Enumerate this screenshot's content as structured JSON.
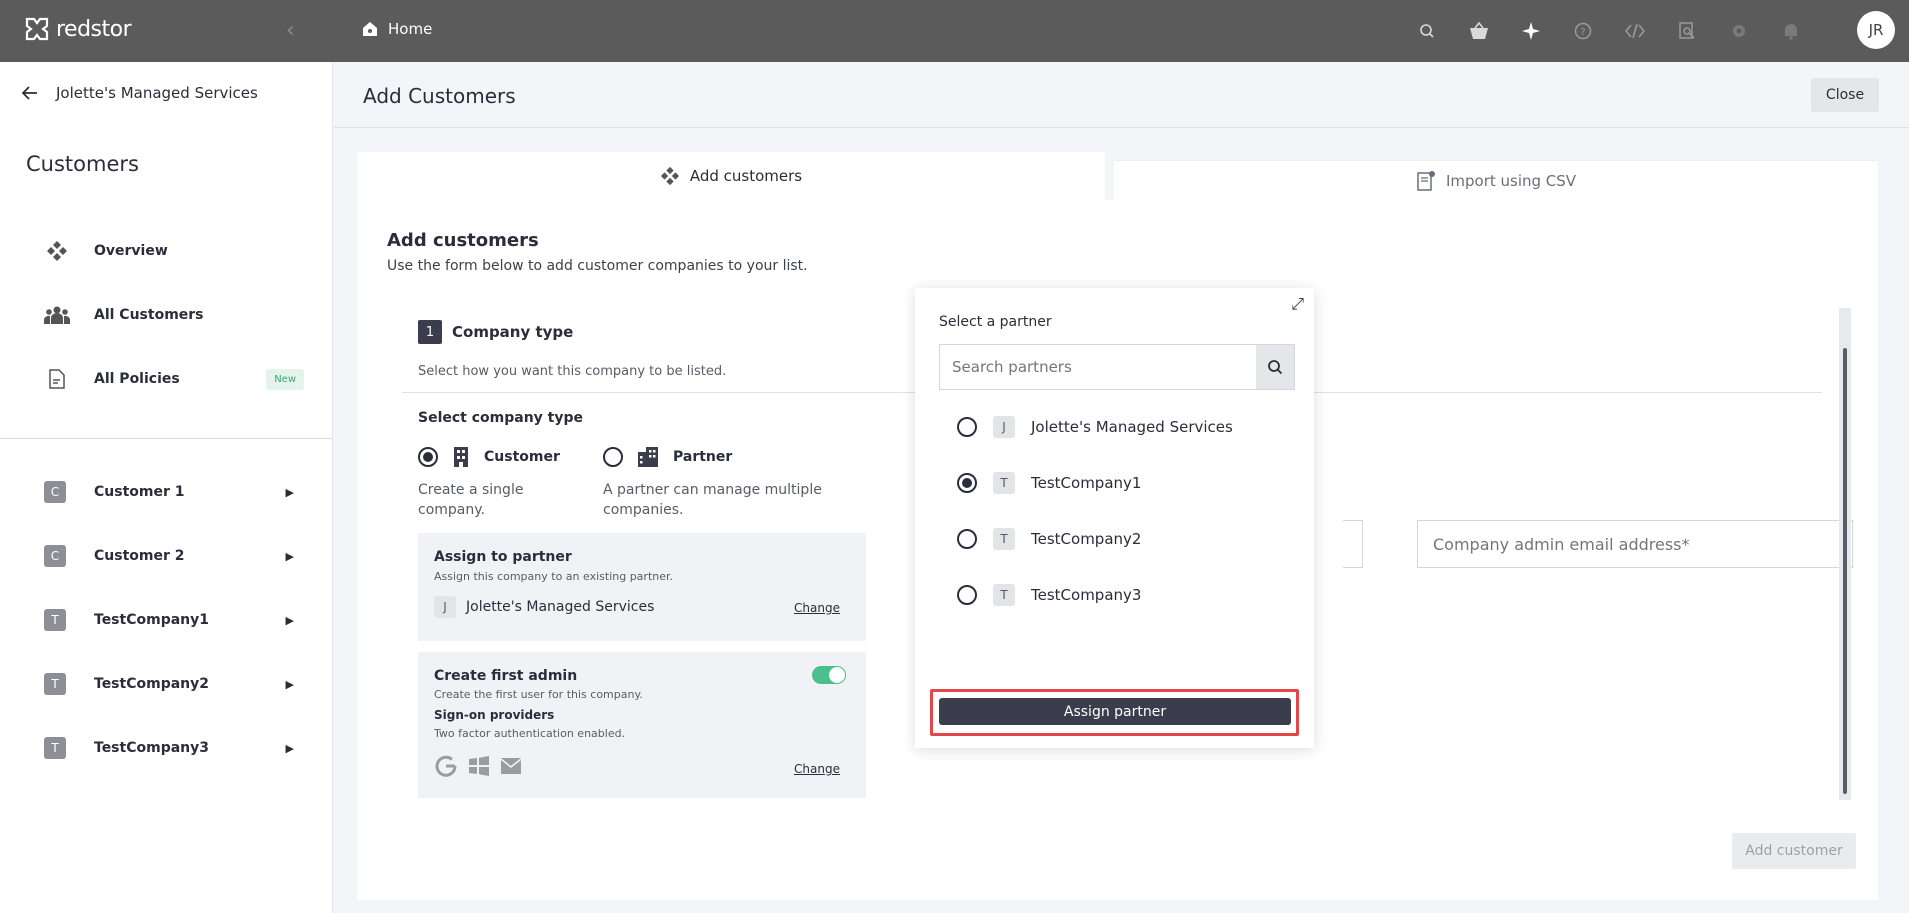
{
  "app": {
    "brand": "redstor",
    "breadcrumb": "Home",
    "user_initials": "JR"
  },
  "topbar": {
    "icons": [
      "search-icon",
      "basket-icon",
      "sparkle-icon",
      "help-icon",
      "code-icon",
      "inspect-icon",
      "gear-icon",
      "bell-icon"
    ]
  },
  "sidebar": {
    "back_label": "Jolette's Managed Services",
    "title": "Customers",
    "nav": [
      {
        "label": "Overview",
        "icon": "overview-icon"
      },
      {
        "label": "All Customers",
        "icon": "users-icon"
      },
      {
        "label": "All Policies",
        "icon": "document-icon",
        "badge": "New"
      }
    ],
    "customers": [
      {
        "letter": "C",
        "label": "Customer 1"
      },
      {
        "letter": "C",
        "label": "Customer 2"
      },
      {
        "letter": "T",
        "label": "TestCompany1"
      },
      {
        "letter": "T",
        "label": "TestCompany2"
      },
      {
        "letter": "T",
        "label": "TestCompany3"
      }
    ]
  },
  "main": {
    "title": "Add Customers",
    "close_label": "Close",
    "tabs": [
      {
        "label": "Add customers",
        "active": true
      },
      {
        "label": "Import using CSV",
        "active": false
      }
    ],
    "card": {
      "title": "Add customers",
      "subtitle": "Use the form below to add customer companies to your list.",
      "step_number": "1",
      "step_title": "Company type",
      "step_subtitle": "Select how you want this company to be listed.",
      "select_title": "Select company type",
      "types": [
        {
          "label": "Customer",
          "description": "Create a single company.",
          "checked": true
        },
        {
          "label": "Partner",
          "description": "A partner can manage multiple companies.",
          "checked": false
        }
      ],
      "assign": {
        "title": "Assign to partner",
        "subtitle": "Assign this company to an existing partner.",
        "letter": "J",
        "value": "Jolette's Managed Services",
        "change": "Change"
      },
      "admin": {
        "title": "Create first admin",
        "subtitle": "Create the first user for this company.",
        "providers_title": "Sign-on providers",
        "providers_sub": "Two factor authentication enabled.",
        "change": "Change",
        "toggle_on": true
      },
      "email_placeholder": "Company admin email address*",
      "add_button": "Add customer"
    }
  },
  "popover": {
    "title": "Select a partner",
    "search_placeholder": "Search partners",
    "options": [
      {
        "letter": "J",
        "label": "Jolette's Managed Services",
        "selected": false
      },
      {
        "letter": "T",
        "label": "TestCompany1",
        "selected": true
      },
      {
        "letter": "T",
        "label": "TestCompany2",
        "selected": false
      },
      {
        "letter": "T",
        "label": "TestCompany3",
        "selected": false
      }
    ],
    "assign_button": "Assign partner",
    "highlight_color": "#e2474a"
  }
}
